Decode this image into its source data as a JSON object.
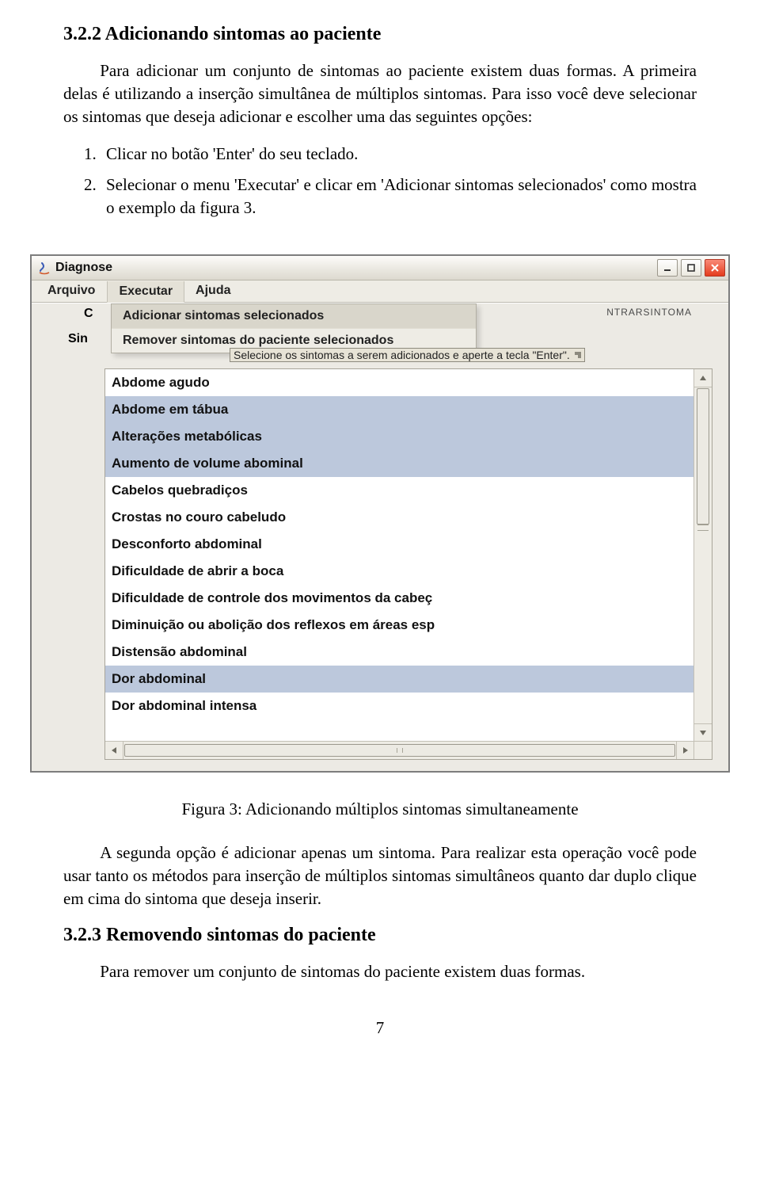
{
  "section322": {
    "heading": "3.2.2    Adicionando sintomas ao paciente",
    "p1": "Para adicionar um conjunto de sintomas ao paciente existem duas formas. A primeira delas é utilizando a inserção simultânea de múltiplos sintomas. Para isso você deve selecionar os sintomas que deseja adicionar e escolher uma das seguintes opções:",
    "li1": "Clicar no botão 'Enter' do seu teclado.",
    "li2": "Selecionar o menu 'Executar' e clicar em 'Adicionar sintomas selecionados' como mostra o exemplo da figura 3."
  },
  "figure": {
    "window_title": "Diagnose",
    "menubar": {
      "arquivo": "Arquivo",
      "executar": "Executar",
      "ajuda": "Ajuda"
    },
    "panel": {
      "labelC": "C",
      "labelSin": "Sin",
      "sintoma_text": "NTRARSINTOMA"
    },
    "executar_menu": {
      "item1": "Adicionar sintomas selecionados",
      "item2": "Remover sintomas do paciente selecionados"
    },
    "tooltip": "Selecione os sintomas a serem adicionados e aperte a tecla \"Enter\".",
    "list": [
      "Abdome agudo",
      "Abdome em tábua",
      "Alterações metabólicas",
      "Aumento de volume abominal",
      "Cabelos quebradiços",
      "Crostas no couro cabeludo",
      "Desconforto abdominal",
      "Dificuldade de abrir a boca",
      "Dificuldade de controle dos movimentos da cabeç",
      "Diminuição ou abolição dos reflexos em áreas esp",
      "Distensão abdominal",
      "Dor abdominal",
      "Dor abdominal intensa"
    ],
    "selected_indices": [
      1,
      2,
      3,
      11
    ]
  },
  "caption": "Figura 3: Adicionando múltiplos sintomas simultaneamente",
  "after": {
    "p1": "A segunda opção é adicionar apenas um sintoma. Para realizar esta operação você pode usar tanto os métodos para inserção de múltiplos sintomas simultâneos quanto dar duplo clique em cima do sintoma que deseja inserir."
  },
  "section323": {
    "heading": "3.2.3    Removendo sintomas do paciente",
    "p1": "Para remover um conjunto de sintomas do paciente existem duas formas."
  },
  "page_number": "7"
}
